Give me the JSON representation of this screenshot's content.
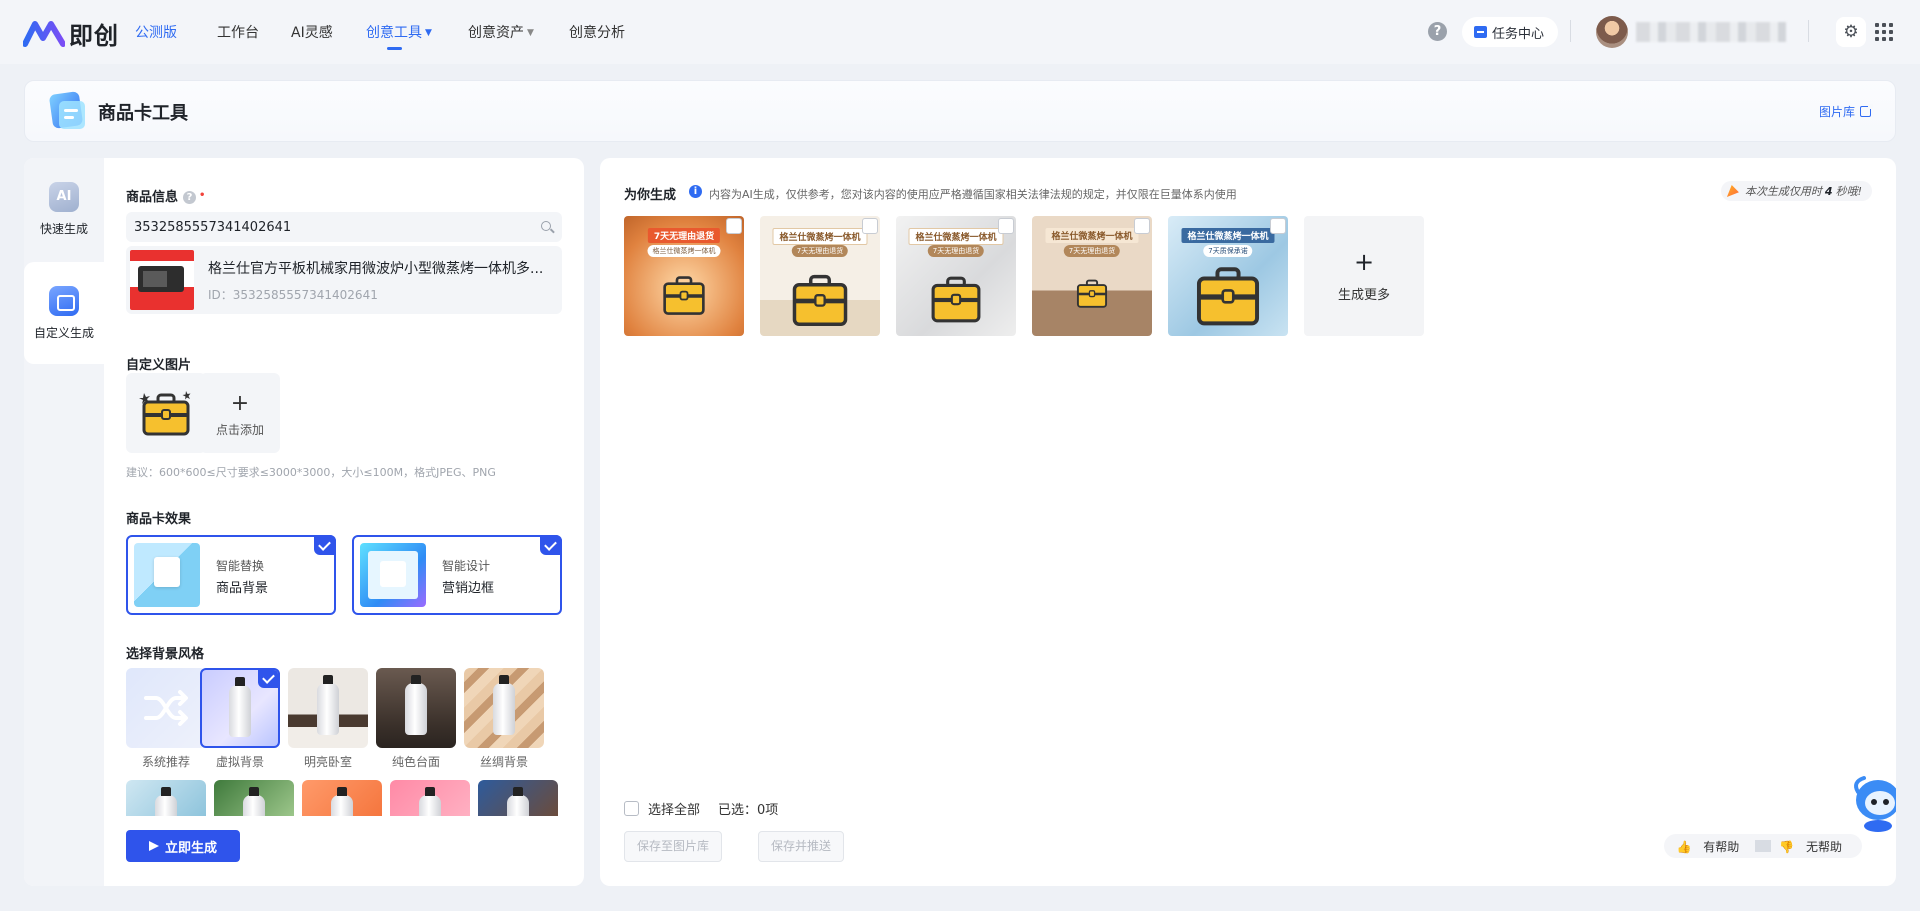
{
  "nav": {
    "brand": "即创",
    "edition": "公测版",
    "items": [
      {
        "label": "工作台",
        "has_caret": false
      },
      {
        "label": "AI灵感",
        "has_caret": false
      },
      {
        "label": "创意工具",
        "has_caret": true,
        "active": true
      },
      {
        "label": "创意资产",
        "has_caret": true
      },
      {
        "label": "创意分析",
        "has_caret": false
      }
    ],
    "help": "?",
    "task_center": "任务中心",
    "accent_color": "#2f6bf2"
  },
  "page_header": {
    "title": "商品卡工具",
    "library_link": "图片库"
  },
  "rail": {
    "items": [
      {
        "label": "快速生成",
        "icon": "ai-icon",
        "icon_text": "AI"
      },
      {
        "label": "自定义生成",
        "icon": "custom-generate-icon",
        "active": true
      }
    ]
  },
  "product_info": {
    "label": "商品信息",
    "required_mark": "•",
    "search_value": "3532585557341402641",
    "product_name": "格兰仕官方平板机械家用微波炉小型微蒸烤一体机多...",
    "product_id": "ID：3532585557341402641"
  },
  "custom_image": {
    "label": "自定义图片",
    "add_label": "点击添加",
    "tip": "建议：600*600≤尺寸要求≤3000*3000，大小≤100M，格式JPEG、PNG"
  },
  "effect": {
    "label": "商品卡效果",
    "cards": [
      {
        "top": "智能替换",
        "bottom": "商品背景",
        "selected": true
      },
      {
        "top": "智能设计",
        "bottom": "营销边框",
        "selected": true
      }
    ]
  },
  "background": {
    "label": "选择背景风格",
    "styles": [
      {
        "label": "系统推荐",
        "selected": false
      },
      {
        "label": "虚拟背景",
        "selected": true
      },
      {
        "label": "明亮卧室",
        "selected": false
      },
      {
        "label": "纯色台面",
        "selected": false
      },
      {
        "label": "丝绸背景",
        "selected": false
      }
    ]
  },
  "generate_button": "立即生成",
  "results": {
    "title": "为你生成",
    "disclaimer": "内容为AI生成，仅供参考，您对该内容的使用应严格遵循国家相关法律法规的规定，并仅限在巨量体系内使用",
    "time_prefix": "本次生成仅用时",
    "time_value": "4",
    "time_suffix": "秒哦!",
    "cards": [
      {
        "ribbon": "7天无理由退货",
        "sub": "格兰仕微蒸烤一体机"
      },
      {
        "ribbon": "格兰仕微蒸烤一体机",
        "sub": "7天无理由退货"
      },
      {
        "ribbon": "格兰仕微蒸烤一体机",
        "sub": "7天无理由退货"
      },
      {
        "ribbon": "格兰仕微蒸烤一体机",
        "sub": "7天无理由退货"
      },
      {
        "ribbon": "格兰仕微蒸烤一体机",
        "sub": "7天质保承诺"
      }
    ],
    "more_label": "生成更多",
    "select_all": "选择全部",
    "selected_count": "已选：0项",
    "save_library": "保存至图片库",
    "save_push": "保存并推送",
    "helpful": "有帮助",
    "not_helpful": "无帮助"
  }
}
